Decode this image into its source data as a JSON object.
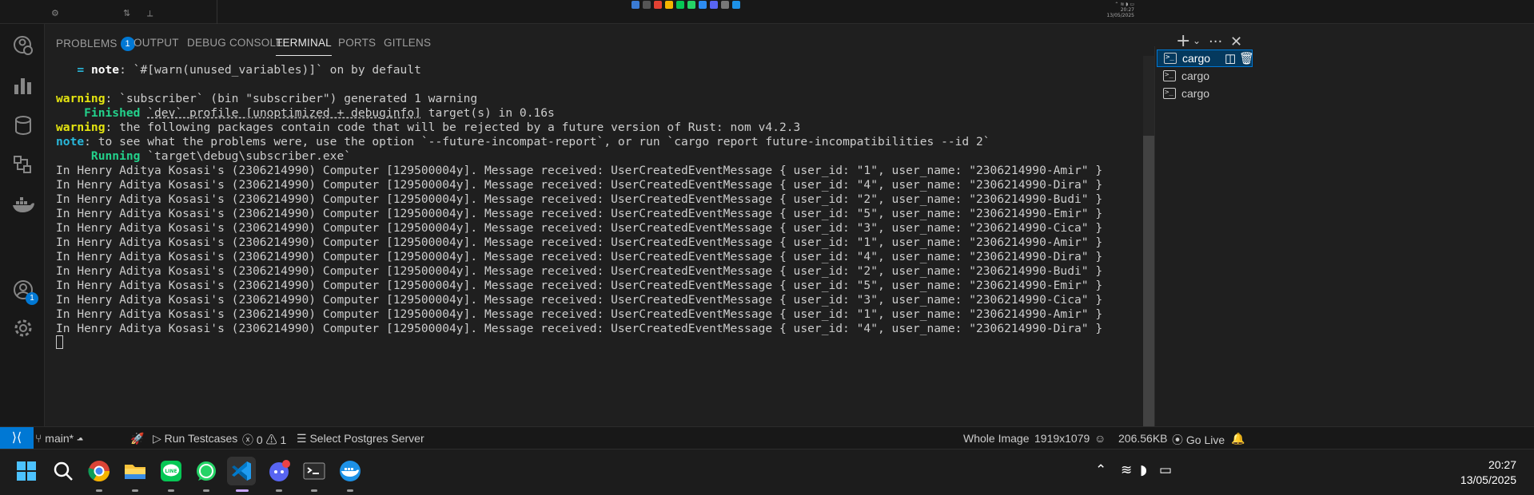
{
  "panel": {
    "tabs": [
      {
        "label": "PROBLEMS",
        "badge": "1"
      },
      {
        "label": "OUTPUT"
      },
      {
        "label": "DEBUG CONSOLE"
      },
      {
        "label": "TERMINAL",
        "active": true
      },
      {
        "label": "PORTS"
      },
      {
        "label": "GITLENS"
      }
    ]
  },
  "terminal": {
    "note_prefix": "   = ",
    "note_label": "note",
    "note_text": ": `#[warn(unused_variables)]` on by default",
    "warn1_label": "warning",
    "warn1_text": ": `subscriber` (bin \"subscriber\") generated 1 warning",
    "finished_label": "    Finished",
    "finished_pre": " ",
    "finished_link": "`dev` profile [unoptimized + debuginfo]",
    "finished_post": " target(s) in 0.16s",
    "warn2_label": "warning",
    "warn2_text": ": the following packages contain code that will be rejected by a future version of Rust: nom v4.2.3",
    "note2_label": "note",
    "note2_text": ": to see what the problems were, use the option `--future-incompat-report`, or run `cargo report future-incompatibilities --id 2`",
    "running_label": "     Running",
    "running_text": " `target\\debug\\subscriber.exe`",
    "messages": [
      "In Henry Aditya Kosasi's (2306214990) Computer [129500004y]. Message received: UserCreatedEventMessage { user_id: \"1\", user_name: \"2306214990-Amir\" }",
      "In Henry Aditya Kosasi's (2306214990) Computer [129500004y]. Message received: UserCreatedEventMessage { user_id: \"4\", user_name: \"2306214990-Dira\" }",
      "In Henry Aditya Kosasi's (2306214990) Computer [129500004y]. Message received: UserCreatedEventMessage { user_id: \"2\", user_name: \"2306214990-Budi\" }",
      "In Henry Aditya Kosasi's (2306214990) Computer [129500004y]. Message received: UserCreatedEventMessage { user_id: \"5\", user_name: \"2306214990-Emir\" }",
      "In Henry Aditya Kosasi's (2306214990) Computer [129500004y]. Message received: UserCreatedEventMessage { user_id: \"3\", user_name: \"2306214990-Cica\" }",
      "In Henry Aditya Kosasi's (2306214990) Computer [129500004y]. Message received: UserCreatedEventMessage { user_id: \"1\", user_name: \"2306214990-Amir\" }",
      "In Henry Aditya Kosasi's (2306214990) Computer [129500004y]. Message received: UserCreatedEventMessage { user_id: \"4\", user_name: \"2306214990-Dira\" }",
      "In Henry Aditya Kosasi's (2306214990) Computer [129500004y]. Message received: UserCreatedEventMessage { user_id: \"2\", user_name: \"2306214990-Budi\" }",
      "In Henry Aditya Kosasi's (2306214990) Computer [129500004y]. Message received: UserCreatedEventMessage { user_id: \"5\", user_name: \"2306214990-Emir\" }",
      "In Henry Aditya Kosasi's (2306214990) Computer [129500004y]. Message received: UserCreatedEventMessage { user_id: \"3\", user_name: \"2306214990-Cica\" }",
      "In Henry Aditya Kosasi's (2306214990) Computer [129500004y]. Message received: UserCreatedEventMessage { user_id: \"1\", user_name: \"2306214990-Amir\" }",
      "In Henry Aditya Kosasi's (2306214990) Computer [129500004y]. Message received: UserCreatedEventMessage { user_id: \"4\", user_name: \"2306214990-Dira\" }"
    ]
  },
  "terminal_list": [
    "cargo",
    "cargo",
    "cargo"
  ],
  "activity": {
    "accounts_badge": "1"
  },
  "status_bar": {
    "branch": "main*",
    "run_testcases": "Run Testcases",
    "errors": "0",
    "warnings": "1",
    "postgres": "Select Postgres Server",
    "whole_image": "Whole Image",
    "dimensions": "1919x1079",
    "file_size": "206.56KB",
    "go_live": "Go Live"
  },
  "taskbar": {
    "time": "20:27",
    "date": "13/05/2025",
    "apps": [
      "start-icon",
      "search-icon",
      "chrome-icon",
      "file-explorer-icon",
      "line-icon",
      "whatsapp-icon",
      "vscode-icon",
      "discord-icon",
      "terminal-icon",
      "docker-icon"
    ]
  },
  "colors": {
    "accent": "#0078d4",
    "warning": "#e5e510",
    "success": "#23d18b",
    "note": "#29b8db"
  }
}
